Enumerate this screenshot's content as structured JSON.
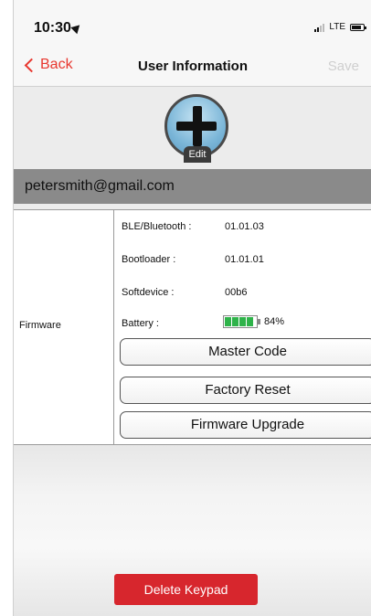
{
  "status_bar": {
    "time": "10:30",
    "network": "LTE"
  },
  "nav": {
    "back_label": "Back",
    "title": "User Information",
    "save_label": "Save"
  },
  "avatar": {
    "edit_label": "Edit"
  },
  "user": {
    "email": "petersmith@gmail.com"
  },
  "firmware": {
    "section_label": "Firmware",
    "rows": [
      {
        "label": "BLE/Bluetooth :",
        "value": "01.01.03"
      },
      {
        "label": "Bootloader :",
        "value": "01.01.01"
      },
      {
        "label": "Softdevice :",
        "value": "00b6"
      },
      {
        "label": "Battery :",
        "value": "84%"
      }
    ],
    "battery_level": 0.84,
    "buttons": {
      "master_code": "Master Code",
      "factory_reset": "Factory Reset",
      "firmware_upgrade": "Firmware Upgrade"
    }
  },
  "actions": {
    "delete_label": "Delete Keypad"
  },
  "colors": {
    "accent": "#e8362e",
    "delete_button": "#d7262d",
    "battery_fill": "#2fb34a"
  }
}
